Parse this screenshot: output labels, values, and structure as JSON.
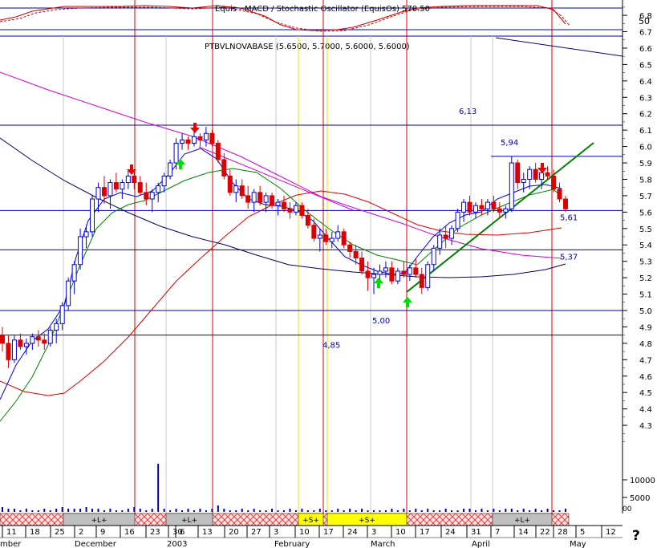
{
  "chart_data": {
    "type": "candlestick",
    "symbol_label": "PTBVLNOVABASE (5.6500, 5.7000, 5.6000, 5.6000)",
    "indicator_label": "Equis - MACD / Stochastic Oscillator (EquisOs) 570.50",
    "indicator_level_label": "50",
    "price_axis": {
      "min": 4.2,
      "max": 6.85,
      "ticks": [
        "6.8",
        "6.7",
        "6.6",
        "6.5",
        "6.4",
        "6.3",
        "6.2",
        "6.1",
        "6.0",
        "5.9",
        "5.8",
        "5.7",
        "5.6",
        "5.5",
        "5.4",
        "5.3",
        "5.2",
        "5.1",
        "5.0",
        "4.9",
        "4.8",
        "4.7",
        "4.6",
        "4.5",
        "4.4",
        "4.3"
      ]
    },
    "volume_axis": {
      "ticks": [
        "10000",
        "5000"
      ],
      "unit_label": "00"
    },
    "horizontal_levels": [
      {
        "value": 6.13,
        "label": "6,13"
      },
      {
        "value": 5.94,
        "label": "5,94"
      },
      {
        "value": 5.61,
        "label": "5,61"
      },
      {
        "value": 5.37,
        "label": "5,37"
      },
      {
        "value": 5.0,
        "label": "5,00"
      },
      {
        "value": 4.85,
        "label": "4,85"
      }
    ],
    "date_ticks": [
      "11",
      "18",
      "25",
      "2",
      "9",
      "16",
      "23",
      "30",
      "6",
      "13",
      "20",
      "27",
      "3",
      "10",
      "17",
      "24",
      "3",
      "10",
      "17",
      "24",
      "31",
      "7",
      "14",
      "22",
      "28",
      "5",
      "12"
    ],
    "month_labels": [
      "mber",
      "December",
      "2003",
      "February",
      "March",
      "April",
      "May"
    ],
    "signal_band": [
      {
        "label": "+L+"
      },
      {
        "label": "+L+"
      },
      {
        "label": "+S+"
      },
      {
        "label": "+S+"
      },
      {
        "label": "+L+"
      }
    ],
    "candles": [
      [
        4.85,
        4.9,
        4.75,
        4.8
      ],
      [
        4.8,
        4.85,
        4.65,
        4.7
      ],
      [
        4.7,
        4.85,
        4.68,
        4.82
      ],
      [
        4.82,
        4.86,
        4.76,
        4.78
      ],
      [
        4.78,
        4.83,
        4.73,
        4.8
      ],
      [
        4.8,
        4.86,
        4.76,
        4.84
      ],
      [
        4.84,
        4.88,
        4.78,
        4.82
      ],
      [
        4.82,
        4.86,
        4.76,
        4.8
      ],
      [
        4.8,
        4.9,
        4.78,
        4.88
      ],
      [
        4.88,
        4.95,
        4.8,
        4.92
      ],
      [
        4.92,
        5.05,
        4.88,
        5.03
      ],
      [
        5.03,
        5.2,
        5.0,
        5.18
      ],
      [
        5.18,
        5.3,
        5.1,
        5.28
      ],
      [
        5.28,
        5.5,
        5.25,
        5.45
      ],
      [
        5.45,
        5.52,
        5.38,
        5.48
      ],
      [
        5.48,
        5.7,
        5.45,
        5.68
      ],
      [
        5.68,
        5.78,
        5.6,
        5.75
      ],
      [
        5.75,
        5.82,
        5.65,
        5.7
      ],
      [
        5.7,
        5.8,
        5.62,
        5.78
      ],
      [
        5.78,
        5.84,
        5.72,
        5.74
      ],
      [
        5.74,
        5.8,
        5.68,
        5.78
      ],
      [
        5.78,
        5.86,
        5.74,
        5.82
      ],
      [
        5.82,
        5.86,
        5.74,
        5.78
      ],
      [
        5.78,
        5.82,
        5.7,
        5.72
      ],
      [
        5.72,
        5.78,
        5.64,
        5.68
      ],
      [
        5.68,
        5.74,
        5.6,
        5.72
      ],
      [
        5.72,
        5.78,
        5.66,
        5.76
      ],
      [
        5.76,
        5.84,
        5.72,
        5.82
      ],
      [
        5.82,
        5.92,
        5.8,
        5.9
      ],
      [
        5.9,
        6.05,
        5.86,
        6.02
      ],
      [
        6.02,
        6.08,
        5.98,
        6.04
      ],
      [
        6.04,
        6.06,
        5.98,
        6.02
      ],
      [
        6.02,
        6.1,
        6.0,
        6.06
      ],
      [
        6.06,
        6.08,
        6.0,
        6.04
      ],
      [
        6.04,
        6.12,
        6.0,
        6.08
      ],
      [
        6.08,
        6.1,
        6.0,
        6.02
      ],
      [
        6.02,
        6.04,
        5.9,
        5.92
      ],
      [
        5.92,
        5.96,
        5.8,
        5.82
      ],
      [
        5.82,
        5.86,
        5.7,
        5.72
      ],
      [
        5.72,
        5.8,
        5.66,
        5.76
      ],
      [
        5.76,
        5.8,
        5.68,
        5.7
      ],
      [
        5.7,
        5.76,
        5.62,
        5.66
      ],
      [
        5.66,
        5.74,
        5.6,
        5.72
      ],
      [
        5.72,
        5.76,
        5.64,
        5.66
      ],
      [
        5.66,
        5.72,
        5.6,
        5.7
      ],
      [
        5.7,
        5.72,
        5.62,
        5.64
      ],
      [
        5.64,
        5.68,
        5.58,
        5.66
      ],
      [
        5.66,
        5.7,
        5.6,
        5.62
      ],
      [
        5.62,
        5.66,
        5.56,
        5.6
      ],
      [
        5.6,
        5.66,
        5.58,
        5.64
      ],
      [
        5.64,
        5.66,
        5.56,
        5.58
      ],
      [
        5.58,
        5.62,
        5.5,
        5.52
      ],
      [
        5.52,
        5.56,
        5.42,
        5.44
      ],
      [
        5.44,
        5.5,
        5.36,
        5.46
      ],
      [
        5.46,
        5.5,
        5.4,
        5.42
      ],
      [
        5.42,
        5.48,
        5.38,
        5.44
      ],
      [
        5.44,
        5.52,
        5.42,
        5.48
      ],
      [
        5.48,
        5.5,
        5.38,
        5.4
      ],
      [
        5.4,
        5.42,
        5.32,
        5.36
      ],
      [
        5.36,
        5.4,
        5.28,
        5.32
      ],
      [
        5.32,
        5.36,
        5.22,
        5.24
      ],
      [
        5.24,
        5.3,
        5.12,
        5.2
      ],
      [
        5.2,
        5.26,
        5.1,
        5.22
      ],
      [
        5.22,
        5.28,
        5.18,
        5.24
      ],
      [
        5.24,
        5.3,
        5.2,
        5.26
      ],
      [
        5.26,
        5.3,
        5.16,
        5.18
      ],
      [
        5.18,
        5.26,
        5.16,
        5.24
      ],
      [
        5.24,
        5.3,
        5.2,
        5.22
      ],
      [
        5.22,
        5.28,
        5.18,
        5.26
      ],
      [
        5.26,
        5.32,
        5.2,
        5.22
      ],
      [
        5.22,
        5.26,
        5.1,
        5.14
      ],
      [
        5.14,
        5.3,
        5.12,
        5.28
      ],
      [
        5.28,
        5.4,
        5.24,
        5.38
      ],
      [
        5.38,
        5.5,
        5.34,
        5.46
      ],
      [
        5.46,
        5.52,
        5.38,
        5.44
      ],
      [
        5.44,
        5.52,
        5.4,
        5.5
      ],
      [
        5.5,
        5.62,
        5.48,
        5.6
      ],
      [
        5.6,
        5.68,
        5.54,
        5.66
      ],
      [
        5.66,
        5.7,
        5.58,
        5.6
      ],
      [
        5.6,
        5.66,
        5.56,
        5.64
      ],
      [
        5.64,
        5.68,
        5.58,
        5.62
      ],
      [
        5.62,
        5.68,
        5.58,
        5.66
      ],
      [
        5.66,
        5.7,
        5.6,
        5.62
      ],
      [
        5.62,
        5.66,
        5.56,
        5.6
      ],
      [
        5.6,
        5.64,
        5.56,
        5.62
      ],
      [
        5.62,
        5.94,
        5.6,
        5.9
      ],
      [
        5.9,
        5.92,
        5.74,
        5.78
      ],
      [
        5.78,
        5.84,
        5.72,
        5.8
      ],
      [
        5.8,
        5.88,
        5.74,
        5.86
      ],
      [
        5.86,
        5.9,
        5.78,
        5.8
      ],
      [
        5.8,
        5.86,
        5.74,
        5.84
      ],
      [
        5.84,
        5.88,
        5.8,
        5.82
      ],
      [
        5.82,
        5.86,
        5.72,
        5.74
      ],
      [
        5.74,
        5.78,
        5.66,
        5.68
      ],
      [
        5.68,
        5.7,
        5.6,
        5.62
      ]
    ],
    "volumes": [
      3,
      2,
      2,
      1,
      2,
      1,
      1,
      2,
      1,
      2,
      3,
      2,
      2,
      2,
      3,
      2,
      2,
      1,
      2,
      1,
      1,
      2,
      3,
      2,
      1,
      2,
      30,
      2,
      1,
      2,
      1,
      2,
      1,
      2,
      1,
      2,
      4,
      2,
      1,
      1,
      2,
      1,
      2,
      1,
      1,
      2,
      1,
      1,
      2,
      1,
      2,
      1,
      1,
      2,
      1,
      1,
      2,
      1,
      2,
      1,
      2,
      1,
      1,
      1,
      1,
      2,
      1,
      2,
      1,
      2,
      1,
      2,
      1,
      1,
      2,
      1,
      1,
      2,
      2,
      1,
      2,
      1,
      2,
      1,
      2,
      2,
      1,
      2,
      1,
      2,
      1,
      2,
      1,
      1,
      2
    ],
    "vertical_markers": [
      "signal-line-1",
      "signal-line-2",
      "signal-line-3",
      "signal-line-4",
      "signal-line-5"
    ]
  }
}
